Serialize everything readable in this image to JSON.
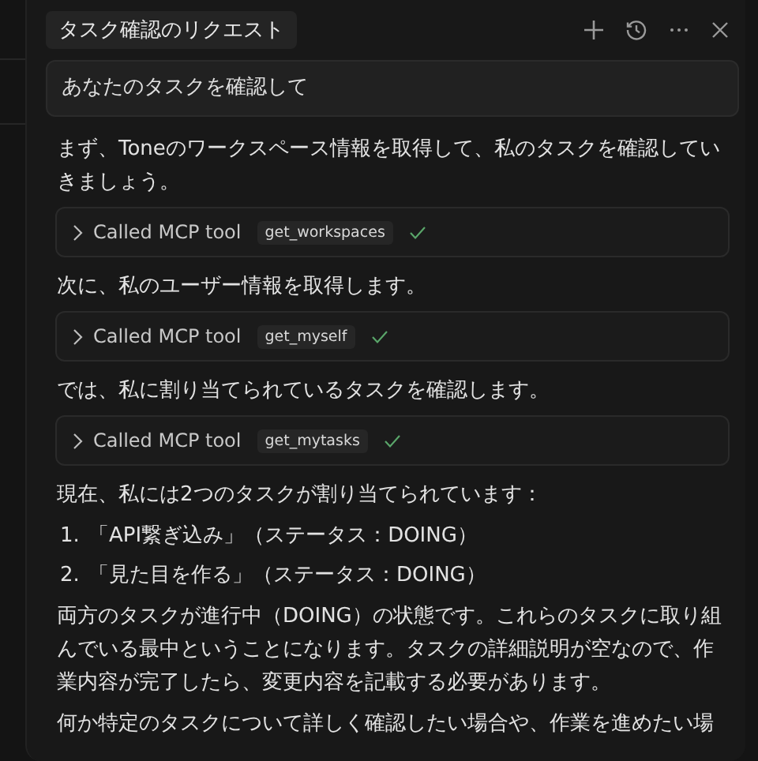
{
  "header": {
    "title": "タスク確認のリクエスト"
  },
  "user_message": "あなたのタスクを確認して",
  "messages": [
    {
      "kind": "text",
      "text": "まず、Toneのワークスペース情報を取得して、私のタスクを確認していきましょう。"
    },
    {
      "kind": "tool_call",
      "label": "Called MCP tool",
      "tool": "get_workspaces",
      "done": true
    },
    {
      "kind": "text",
      "text": "次に、私のユーザー情報を取得します。"
    },
    {
      "kind": "tool_call",
      "label": "Called MCP tool",
      "tool": "get_myself",
      "done": true
    },
    {
      "kind": "text",
      "text": "では、私に割り当てられているタスクを確認します。"
    },
    {
      "kind": "tool_call",
      "label": "Called MCP tool",
      "tool": "get_mytasks",
      "done": true
    },
    {
      "kind": "text",
      "text": "現在、私には2つのタスクが割り当てられています："
    },
    {
      "kind": "list",
      "items": [
        {
          "number": "1.",
          "text": "「API繋ぎ込み」（ステータス：DOING）"
        },
        {
          "number": "2.",
          "text": "「見た目を作る」（ステータス：DOING）"
        }
      ]
    },
    {
      "kind": "text",
      "text": "両方のタスクが進行中（DOING）の状態です。これらのタスクに取り組んでいる最中ということになります。タスクの詳細説明が空なので、作業内容が完了したら、変更内容を記載する必要があります。"
    },
    {
      "kind": "text",
      "text": "何か特定のタスクについて詳しく確認したい場合や、作業を進めたい場"
    }
  ]
}
